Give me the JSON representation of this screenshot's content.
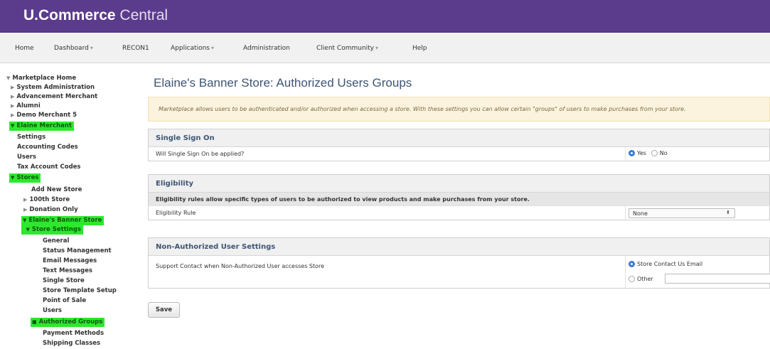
{
  "brand": {
    "bold": "U.Commerce",
    "light": "Central"
  },
  "nav": {
    "home": "Home",
    "dashboard": "Dashboard",
    "recon1": "RECON1",
    "applications": "Applications",
    "administration": "Administration",
    "client_community": "Client Community",
    "help": "Help"
  },
  "tree": {
    "marketplace_home": "Marketplace Home",
    "system_administration": "System Administration",
    "advancement_merchant": "Advancement Merchant",
    "alumni": "Alumni",
    "demo_merchant_5": "Demo Merchant 5",
    "elaine_merchant": "Elaine Merchant",
    "settings": "Settings",
    "accounting_codes": "Accounting Codes",
    "users": "Users",
    "tax_account_codes": "Tax Account Codes",
    "stores": "Stores",
    "add_new_store": "Add New Store",
    "store_100th": "100th Store",
    "donation_only": "Donation Only",
    "elaines_banner_store": "Elaine's Banner Store",
    "store_settings": "Store Settings",
    "general": "General",
    "status_management": "Status Management",
    "email_messages": "Email Messages",
    "text_messages": "Text Messages",
    "single_store": "Single Store",
    "store_template_setup": "Store Template Setup",
    "point_of_sale": "Point of Sale",
    "users2": "Users",
    "authorized_groups": "Authorized Groups",
    "payment_methods": "Payment Methods",
    "shipping_classes": "Shipping Classes"
  },
  "page": {
    "title": "Elaine's Banner Store: Authorized Users Groups",
    "notice": "Marketplace allows users to be authenticated and/or authorized when accessing a store. With these settings you can allow certain \"groups\" of users to make purchases from your store."
  },
  "sso": {
    "header": "Single Sign On",
    "question": "Will Single Sign On be applied?",
    "yes": "Yes",
    "no": "No"
  },
  "eligibility": {
    "header": "Eligibility",
    "description": "Eligibility rules allow specific types of users to be authorized to view products and make purchases from your store.",
    "rule_label": "Eligibility Rule",
    "rule_value": "None"
  },
  "non_auth": {
    "header": "Non-Authorized User Settings",
    "label": "Support Contact when Non-Authorized User accesses Store",
    "option_email": "Store Contact Us Email",
    "option_other": "Other",
    "other_value": ""
  },
  "save_label": "Save",
  "colors": {
    "brand_bar": "#5b3b8c",
    "tree_highlight": "#2ee82e",
    "title_blue": "#3d5575"
  }
}
